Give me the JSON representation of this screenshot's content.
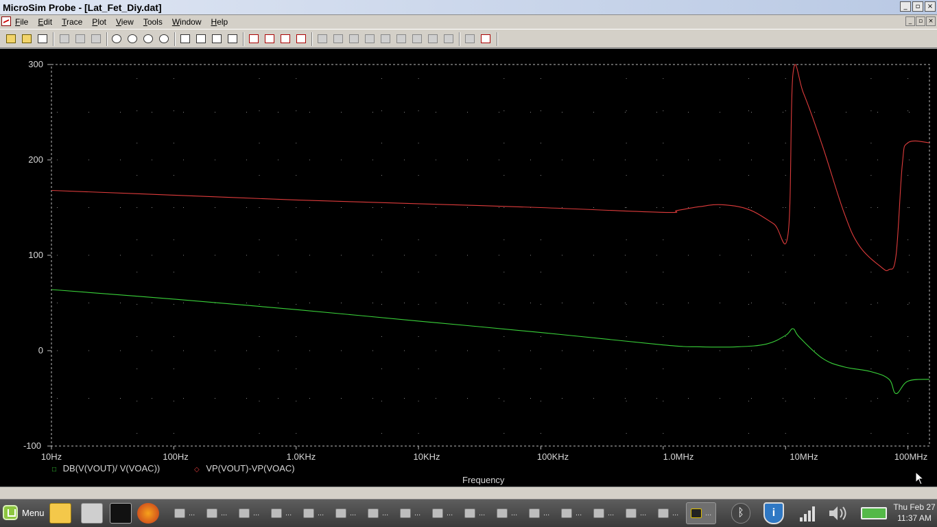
{
  "window": {
    "title": "MicroSim Probe - [Lat_Fet_Diy.dat]"
  },
  "menu": {
    "items": [
      "File",
      "Edit",
      "Trace",
      "Plot",
      "View",
      "Tools",
      "Window",
      "Help"
    ]
  },
  "toolbar": {
    "buttons": [
      "open-file",
      "append-file",
      "print",
      "cut",
      "copy",
      "paste",
      "zoom-in",
      "zoom-out",
      "zoom-area",
      "zoom-fit",
      "x-axis",
      "y-axis",
      "fourier",
      "add-plot",
      "add-trace",
      "cursor-peak",
      "cursor-trough",
      "cursor-max-slope",
      "cursor-min",
      "cursor-max",
      "cursor-point",
      "cursor-search",
      "cursor-next-transition",
      "cursor-prev-transition",
      "mark-data-points",
      "toggle-cursor"
    ]
  },
  "plot": {
    "xaxis": {
      "ticks": [
        "10Hz",
        "100Hz",
        "1.0KHz",
        "10KHz",
        "100KHz",
        "1.0MHz",
        "10MHz",
        "100MHz"
      ],
      "title": "Frequency"
    },
    "yaxis": {
      "ticks": [
        "300",
        "200",
        "100",
        "0",
        "-100"
      ]
    },
    "legend": [
      {
        "name": "DB(V(VOUT)/ V(VOAC))",
        "color": "#3ad33a",
        "marker": "□"
      },
      {
        "name": "VP(VOUT)-VP(VOAC)",
        "color": "#e03c3c",
        "marker": "◇"
      }
    ]
  },
  "chart_data": {
    "type": "line",
    "xscale": "log",
    "xlabel": "Frequency",
    "xlim": [
      10,
      150000000
    ],
    "ylim": [
      -100,
      300
    ],
    "grid": "dotted",
    "legend_position": "bottom-left",
    "series": [
      {
        "name": "DB(V(VOUT)/ V(VOAC))",
        "color": "#3ad33a",
        "points": [
          [
            10,
            64
          ],
          [
            100,
            54
          ],
          [
            1000,
            43
          ],
          [
            10000,
            31
          ],
          [
            100000,
            19
          ],
          [
            1000000,
            6
          ],
          [
            2000000,
            4
          ],
          [
            4000000,
            4
          ],
          [
            7000000,
            7
          ],
          [
            10000000,
            16
          ],
          [
            11500000,
            23
          ],
          [
            13000000,
            14
          ],
          [
            20000000,
            -8
          ],
          [
            30000000,
            -17
          ],
          [
            50000000,
            -22
          ],
          [
            70000000,
            -30
          ],
          [
            80000000,
            -45
          ],
          [
            100000000,
            -32
          ],
          [
            150000000,
            -30
          ]
        ]
      },
      {
        "name": "VP(VOUT)-VP(VOAC)",
        "color": "#e03c3c",
        "points": [
          [
            10,
            168
          ],
          [
            100,
            163
          ],
          [
            1000,
            158
          ],
          [
            10000,
            154
          ],
          [
            100000,
            150
          ],
          [
            1000000,
            145
          ],
          [
            1300000,
            147
          ],
          [
            2000000,
            151
          ],
          [
            3000000,
            153
          ],
          [
            5000000,
            148
          ],
          [
            8000000,
            133
          ],
          [
            10500000,
            123
          ],
          [
            11500000,
            290
          ],
          [
            14000000,
            270
          ],
          [
            20000000,
            215
          ],
          [
            30000000,
            145
          ],
          [
            40000000,
            110
          ],
          [
            60000000,
            88
          ],
          [
            70000000,
            85
          ],
          [
            80000000,
            100
          ],
          [
            90000000,
            195
          ],
          [
            100000000,
            218
          ],
          [
            150000000,
            218
          ]
        ]
      }
    ]
  },
  "taskbar": {
    "menu_label": "Menu",
    "items": [
      "...",
      "...",
      "...",
      "...",
      "...",
      "...",
      "...",
      "...",
      "...",
      "...",
      "...",
      "...",
      "...",
      "...",
      "...",
      "...",
      "..."
    ]
  },
  "clock": {
    "day": "Thu Feb 27",
    "time": "11:37 AM"
  }
}
